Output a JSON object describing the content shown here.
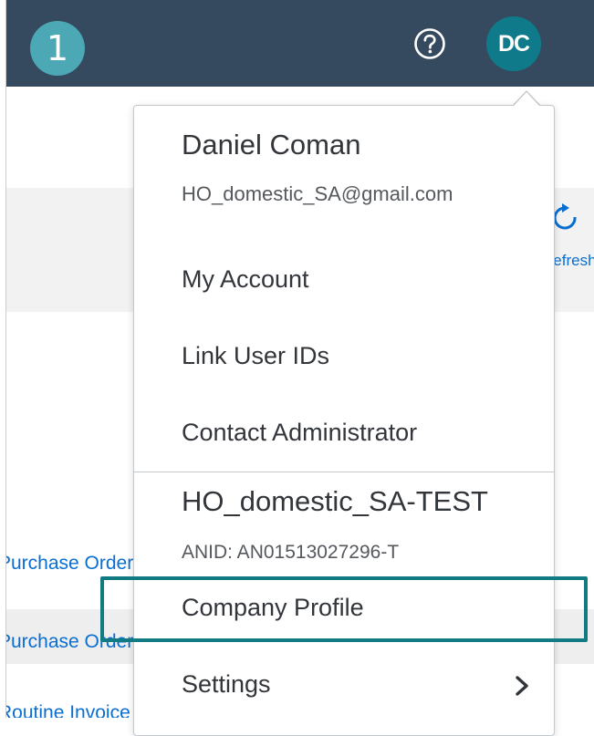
{
  "step": {
    "number": "1"
  },
  "header": {
    "help_icon": "question-circle-icon",
    "avatar_initials": "DC",
    "bg_color": "#354a5f",
    "avatar_color": "#0f7a8a"
  },
  "background": {
    "refresh_label": "Refresh",
    "row1_text": "Purchase Order by",
    "row2_text": "Purchase Order by",
    "row3_text": "Routine Invoice"
  },
  "menu": {
    "user_name": "Daniel Coman",
    "user_email": "HO_domestic_SA@gmail.com",
    "items": [
      {
        "label": "My Account"
      },
      {
        "label": "Link User IDs"
      },
      {
        "label": "Contact Administrator"
      }
    ],
    "company_name": "HO_domestic_SA-TEST",
    "anid": "ANID: AN01513027296-T",
    "company_items": [
      {
        "label": "Company Profile"
      },
      {
        "label": "Settings",
        "icon": "chevron-right-icon"
      }
    ]
  },
  "highlight_color": "#127a82"
}
